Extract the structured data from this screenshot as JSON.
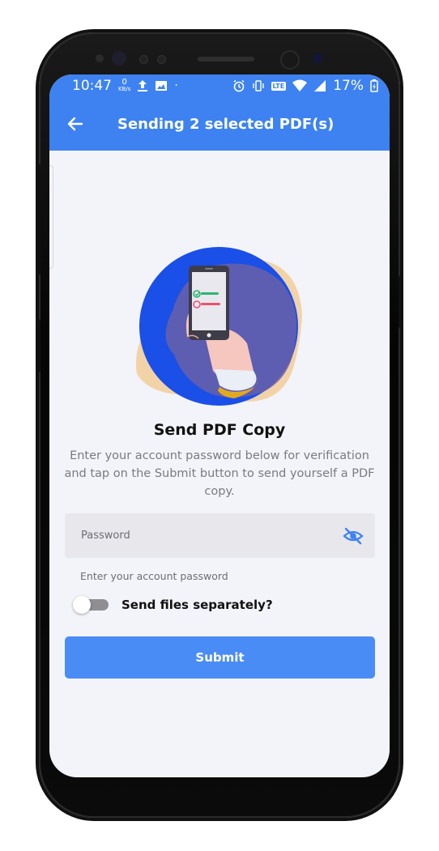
{
  "status_bar": {
    "time": "10:47",
    "network_speed_value": "0",
    "network_speed_unit": "KB/s",
    "lte_label": "LTE",
    "battery": "17%"
  },
  "app_bar": {
    "title": "Sending 2 selected PDF(s)"
  },
  "main": {
    "heading": "Send PDF Copy",
    "description": "Enter your account password below for verification and tap on the Submit button to send yourself a PDF copy.",
    "password_placeholder": "Password",
    "password_value": "",
    "helper_text": "Enter your account password",
    "toggle_label": "Send files separately?",
    "toggle_on": false,
    "submit_label": "Submit"
  },
  "colors": {
    "primary": "#3d82f0",
    "button": "#4a8cf5",
    "illustration_circle": "#1a4fe8",
    "illustration_blob": "#f2d3a8"
  }
}
